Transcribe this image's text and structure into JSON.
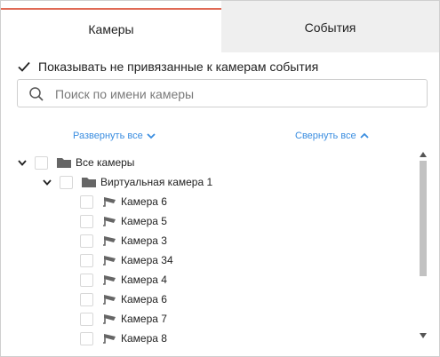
{
  "tabs": {
    "cameras": "Камеры",
    "events": "События"
  },
  "options": {
    "show_unbound_label": "Показывать не привязанные к камерам события",
    "show_unbound_checked": true
  },
  "search": {
    "placeholder": "Поиск по имени камеры",
    "value": ""
  },
  "tree_controls": {
    "expand_all": "Развернуть все",
    "collapse_all": "Свернуть все"
  },
  "tree": {
    "root_label": "Все камеры",
    "group_label": "Виртуальная камера 1",
    "cameras": [
      "Камера 6",
      "Камера 5",
      "Камера 3",
      "Камера 34",
      "Камера 4",
      "Камера 6",
      "Камера 7",
      "Камера 8"
    ]
  },
  "colors": {
    "active_tab_accent": "#e06a55",
    "link": "#3a8de0",
    "inactive_tab_bg": "#efefef",
    "scroll_thumb": "#c2c2c2"
  }
}
